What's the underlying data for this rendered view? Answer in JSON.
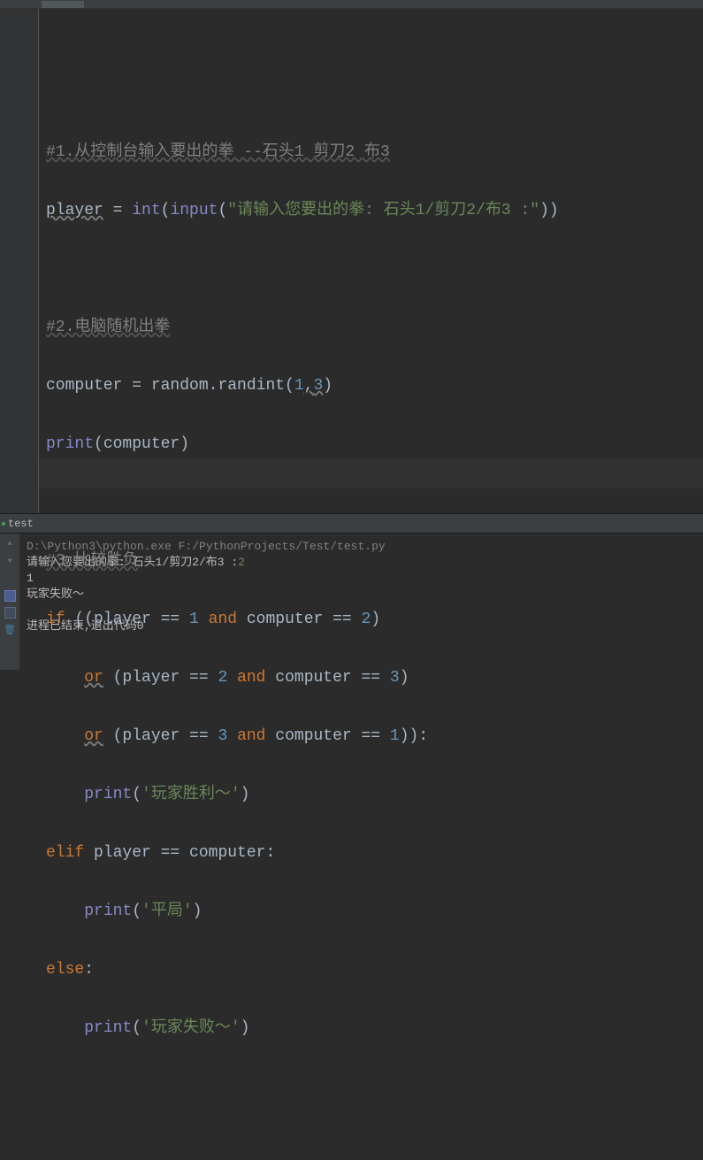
{
  "code": {
    "line1_comment": "#1.从控制台输入要出的拳 --石头1 剪刀2 布3",
    "line2_player": "player",
    "line2_eq": " = ",
    "line2_int": "int",
    "line2_input": "input",
    "line2_string": "\"请输入您要出的拳: 石头1/剪刀2/布3 :\"",
    "line4_comment": "#2.电脑随机出拳",
    "line5_computer": "computer",
    "line5_randint": " = random.randint(",
    "line5_n1": "1",
    "line5_comma_warn": ",",
    "line5_n3": "3",
    "line6_print": "print",
    "line6_arg": "(computer)",
    "line8_comment": "#3.比较胜负",
    "line9_if": "if",
    "line9_rest1": " ((player == ",
    "line9_n1": "1",
    "line9_and": "and",
    "line9_rest2": " computer == ",
    "line9_n2": "2",
    "line9_close": ")",
    "line10_or": "or",
    "line10_rest1": " (player == ",
    "line10_n2": "2",
    "line10_and": "and",
    "line10_rest2": " computer == ",
    "line10_n3": "3",
    "line10_close": ")",
    "line11_or": "or",
    "line11_rest1": " (player == ",
    "line11_n3": "3",
    "line11_and": "and",
    "line11_rest2": " computer == ",
    "line11_n1": "1",
    "line11_close": ")):",
    "line12_print": "print",
    "line12_string": "'玩家胜利～'",
    "line13_elif": "elif",
    "line13_rest": " player == computer:",
    "line14_print": "print",
    "line14_string": "'平局'",
    "line15_else": "else",
    "line15_colon": ":",
    "line16_print": "print",
    "line16_string": "'玩家失败～'"
  },
  "terminal": {
    "tab_name": "test",
    "line1": "D:\\Python3\\python.exe F:/PythonProjects/Test/test.py",
    "line2_prompt": "请输入您要出的拳: 石头1/剪刀2/布3 :",
    "line2_input": "2",
    "line3": "1",
    "line4": "玩家失败～",
    "line6": "进程已结束,退出代码0"
  }
}
